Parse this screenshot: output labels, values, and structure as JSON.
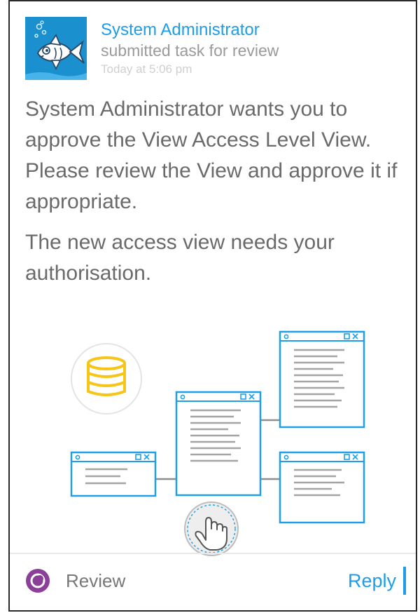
{
  "activity": {
    "sender": "System Administrator",
    "action": "submitted task for review",
    "timestamp": "Today at 5:06 pm"
  },
  "message": {
    "paragraph_1": "System Administrator wants you to approve the View Access Level View. Please review the View and approve it if appropriate.",
    "paragraph_2": "The new access view needs your authorisation."
  },
  "illustration": {
    "icons": [
      "database-icon",
      "view-window-icon",
      "hand-pointer-icon"
    ]
  },
  "footer": {
    "review_label": "Review",
    "reply_label": "Reply"
  },
  "colors": {
    "accent_blue": "#1e9ce8",
    "avatar_blue": "#1b90cf",
    "database_yellow": "#f5c518",
    "review_purple": "#8b3f98",
    "body_text": "#6a6a6a",
    "muted_text": "#9a9a9a"
  }
}
